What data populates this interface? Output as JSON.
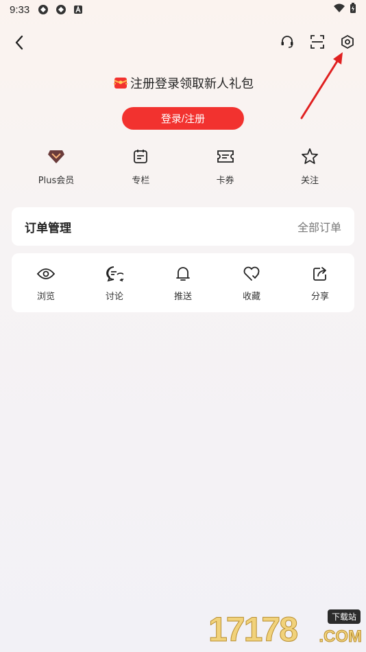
{
  "status_bar": {
    "time": "9:33"
  },
  "promo": {
    "text": "注册登录领取新人礼包"
  },
  "login_button": {
    "label": "登录/注册"
  },
  "quick_links": [
    {
      "label": "Plus会员",
      "icon": "diamond-icon"
    },
    {
      "label": "专栏",
      "icon": "calendar-icon"
    },
    {
      "label": "卡券",
      "icon": "ticket-icon"
    },
    {
      "label": "关注",
      "icon": "star-icon"
    }
  ],
  "orders": {
    "title": "订单管理",
    "all_label": "全部订单"
  },
  "actions": [
    {
      "label": "浏览",
      "icon": "eye-icon"
    },
    {
      "label": "讨论",
      "icon": "chat-icon"
    },
    {
      "label": "推送",
      "icon": "bell-icon"
    },
    {
      "label": "收藏",
      "icon": "heart-icon"
    },
    {
      "label": "分享",
      "icon": "share-icon"
    }
  ],
  "watermark": {
    "number": "17178",
    "tag": "下载站",
    "suffix": ".COM"
  },
  "colors": {
    "accent": "#f2322f",
    "annotation_arrow": "#e02020"
  }
}
